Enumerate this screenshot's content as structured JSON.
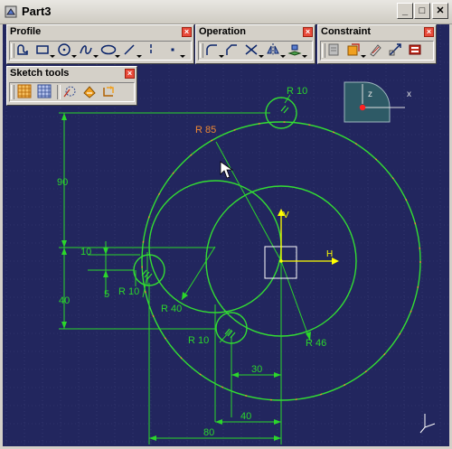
{
  "window": {
    "title": "Part3",
    "minimize_glyph": "_",
    "maximize_glyph": "□",
    "close_glyph": "✕"
  },
  "toolbars": {
    "profile": {
      "title": "Profile",
      "close_glyph": "×",
      "tools": [
        "profile-icon",
        "rectangle-icon",
        "circle-icon",
        "spline-icon",
        "ellipse-icon",
        "line-icon",
        "axis-icon",
        "point-icon"
      ]
    },
    "operation": {
      "title": "Operation",
      "close_glyph": "×",
      "tools": [
        "corner-icon",
        "chamfer-icon",
        "trim-icon",
        "mirror-icon",
        "project-3d-elements-icon"
      ]
    },
    "constraint": {
      "title": "Constraint",
      "close_glyph": "×",
      "tools": [
        "constraint-dialog-icon",
        "constraint-icon",
        "auto-constraint-icon",
        "animate-constraint-icon",
        "edit-multi-constraint-icon"
      ]
    },
    "sketch_tools": {
      "title": "Sketch tools",
      "close_glyph": "×",
      "tools": [
        "grid-icon",
        "snap-to-point-icon",
        "construction-element-icon",
        "geometrical-constraints-icon",
        "dimensional-constraints-icon"
      ]
    }
  },
  "compass": {
    "z_label": "z",
    "x_label": "x"
  },
  "sketch": {
    "h_label": "H",
    "v_label": "V",
    "dimensions": {
      "r10_top": "R 10",
      "r85": "R 85",
      "d90": "90",
      "d10": "10",
      "d5": "5",
      "d40_vertical": "40",
      "r10_left": "R 10",
      "r40": "R 40",
      "r10_bottom": "R 10",
      "r46": "R 46",
      "d30": "30",
      "d40_horizontal": "40",
      "d80": "80"
    }
  },
  "colors": {
    "background": "#22265e",
    "grid": "#3c4078",
    "geometry": "#33dd33",
    "dimension_line": "#2bd62b",
    "selected_dimension": "#ee8833",
    "axis_h": "#ffff00",
    "compass_face": "#2e5a66"
  }
}
